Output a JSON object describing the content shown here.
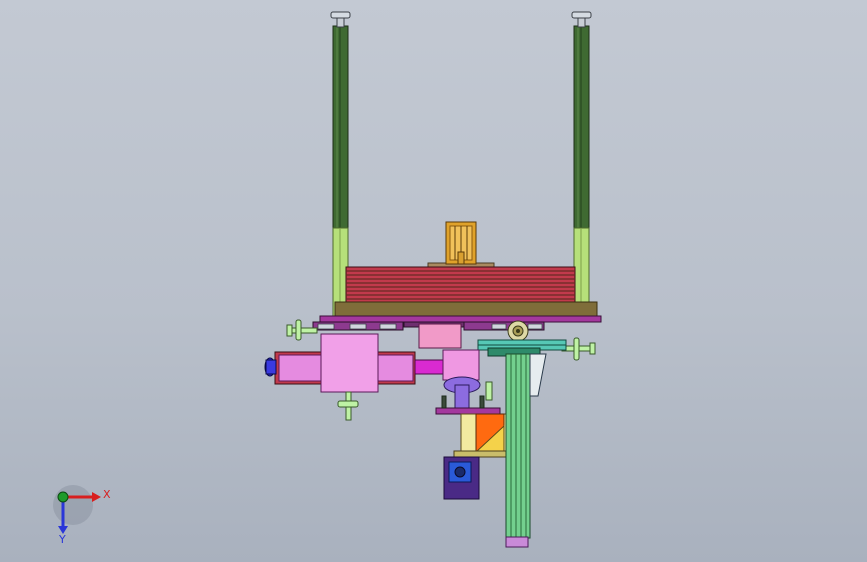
{
  "viewport": {
    "background_top": "#c3c9d3",
    "background_bottom": "#a9b1be"
  },
  "model": {
    "colors": {
      "column_dark": "#3f6a32",
      "column_light": "#b6e07a",
      "stack_red": "#c23a4c",
      "stack_dark": "#6a2a24",
      "plate_olive": "#7f6d3a",
      "motor_orange": "#e0a22a",
      "rail_purple": "#a4389e",
      "block_pink": "#e58be0",
      "block_magenta": "#d92ad1",
      "handle_green": "#bff2a5",
      "vertical_rail_green": "#73d08e",
      "motor_box": "#4a2a86",
      "cylinder_purple": "#8c6ce0",
      "orange_block": "#ff6a10",
      "teal_part": "#56c8b5"
    }
  },
  "triad": {
    "x_label": "X",
    "y_label": "Y",
    "x_color": "#d81f1f",
    "y_color": "#1f9b2a",
    "z_color": "#2a36d8"
  }
}
